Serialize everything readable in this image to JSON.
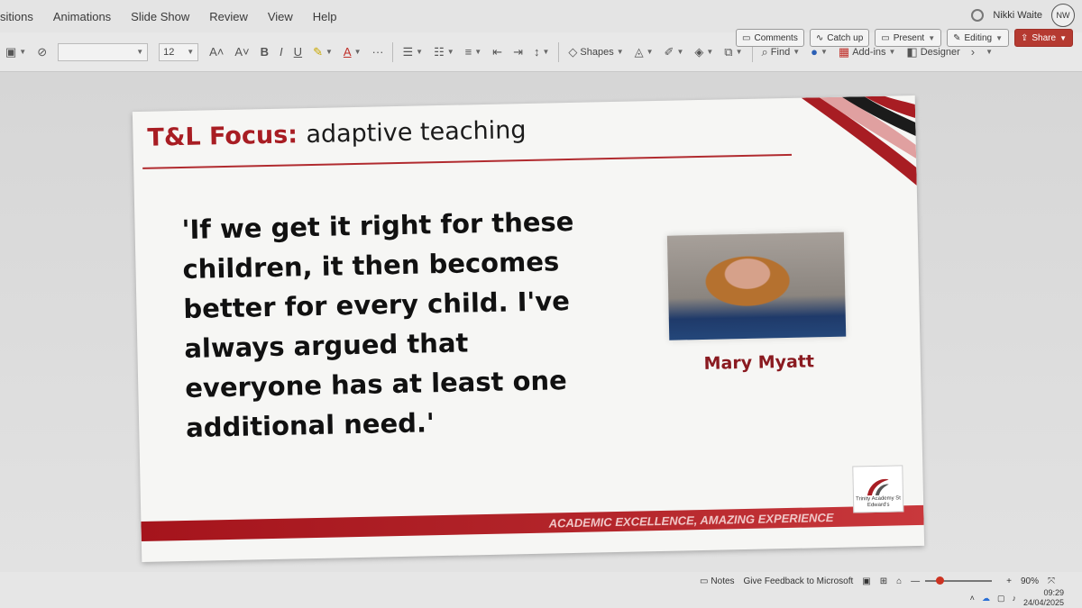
{
  "menu": {
    "tabs": [
      "sitions",
      "Animations",
      "Slide Show",
      "Review",
      "View",
      "Help"
    ]
  },
  "user": {
    "name": "Nikki Waite",
    "initials": "NW"
  },
  "ribbon": {
    "font_size": "12",
    "shapes_label": "Shapes",
    "find_label": "Find",
    "addins_label": "Add-ins",
    "designer_label": "Designer"
  },
  "actions": {
    "comments": "Comments",
    "catchup": "Catch up",
    "present": "Present",
    "editing": "Editing",
    "share": "Share"
  },
  "slide": {
    "title_red": "T&L Focus:",
    "title_black": "adaptive teaching",
    "quote": "'If we get it right for these children, it then becomes better for every child. I've always argued that everyone has at least one additional need.'",
    "caption": "Mary Myatt",
    "footer": "ACADEMIC EXCELLENCE, AMAZING EXPERIENCE",
    "logo_text": "Trinity Academy St Edward's"
  },
  "statusbar": {
    "notes": "Notes",
    "feedback": "Give Feedback to Microsoft",
    "zoom": "90%",
    "time": "09:29",
    "date": "24/04/2025"
  },
  "colors": {
    "brand_red": "#a81d23",
    "share_red": "#b53a31"
  }
}
